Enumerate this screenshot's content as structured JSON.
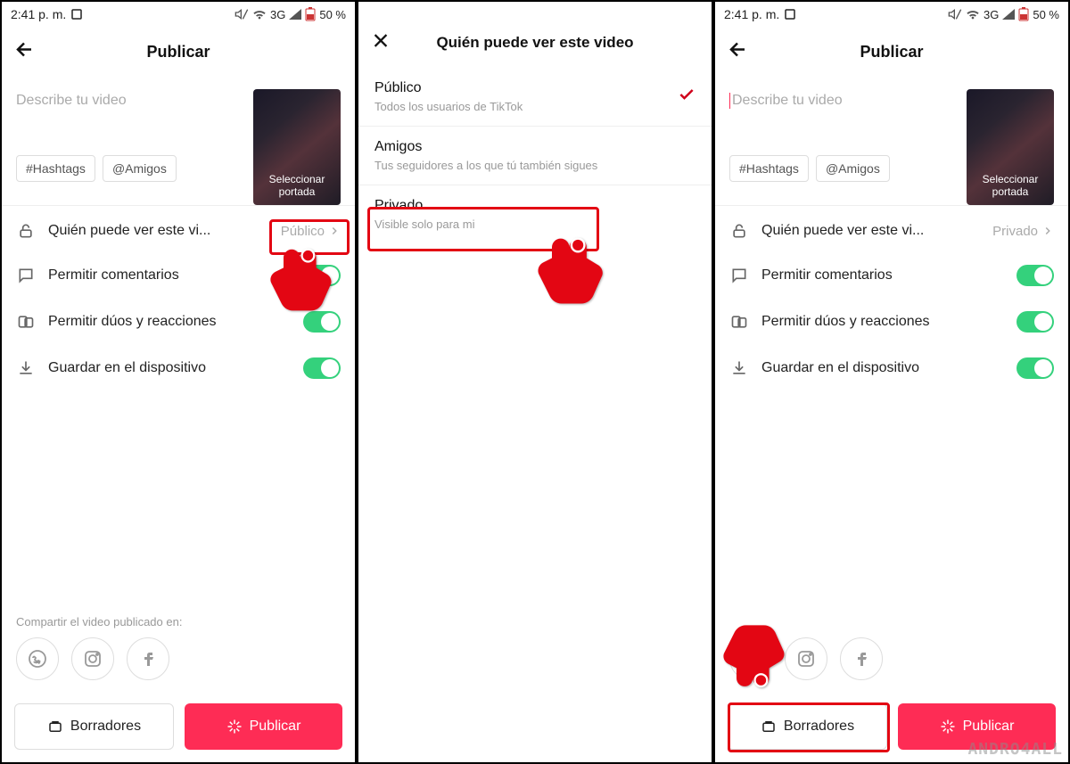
{
  "status": {
    "time": "2:41 p. m.",
    "network": "3G",
    "battery": "50 %"
  },
  "screen1": {
    "title": "Publicar",
    "desc_placeholder": "Describe tu video",
    "chip_hashtags": "#Hashtags",
    "chip_friends": "@Amigos",
    "thumb_label": "Seleccionar portada",
    "privacy_label": "Quién puede ver este vi...",
    "privacy_value": "Público",
    "comments_label": "Permitir comentarios",
    "duets_label": "Permitir dúos y reacciones",
    "save_label": "Guardar en el dispositivo",
    "share_heading": "Compartir el video publicado en:",
    "drafts_btn": "Borradores",
    "publish_btn": "Publicar"
  },
  "screen2": {
    "title": "Quién puede ver este video",
    "options": [
      {
        "title": "Público",
        "sub": "Todos los usuarios de TikTok",
        "selected": true
      },
      {
        "title": "Amigos",
        "sub": "Tus seguidores a los que tú también sigues",
        "selected": false
      },
      {
        "title": "Privado",
        "sub": "Visible solo para mi",
        "selected": false
      }
    ]
  },
  "screen3": {
    "title": "Publicar",
    "desc_placeholder": "Describe tu video",
    "chip_hashtags": "#Hashtags",
    "chip_friends": "@Amigos",
    "thumb_label": "Seleccionar portada",
    "privacy_label": "Quién puede ver este vi...",
    "privacy_value": "Privado",
    "comments_label": "Permitir comentarios",
    "duets_label": "Permitir dúos y reacciones",
    "save_label": "Guardar en el dispositivo",
    "drafts_btn": "Borradores",
    "publish_btn": "Publicar"
  },
  "watermark": "ANDRO4ALL"
}
